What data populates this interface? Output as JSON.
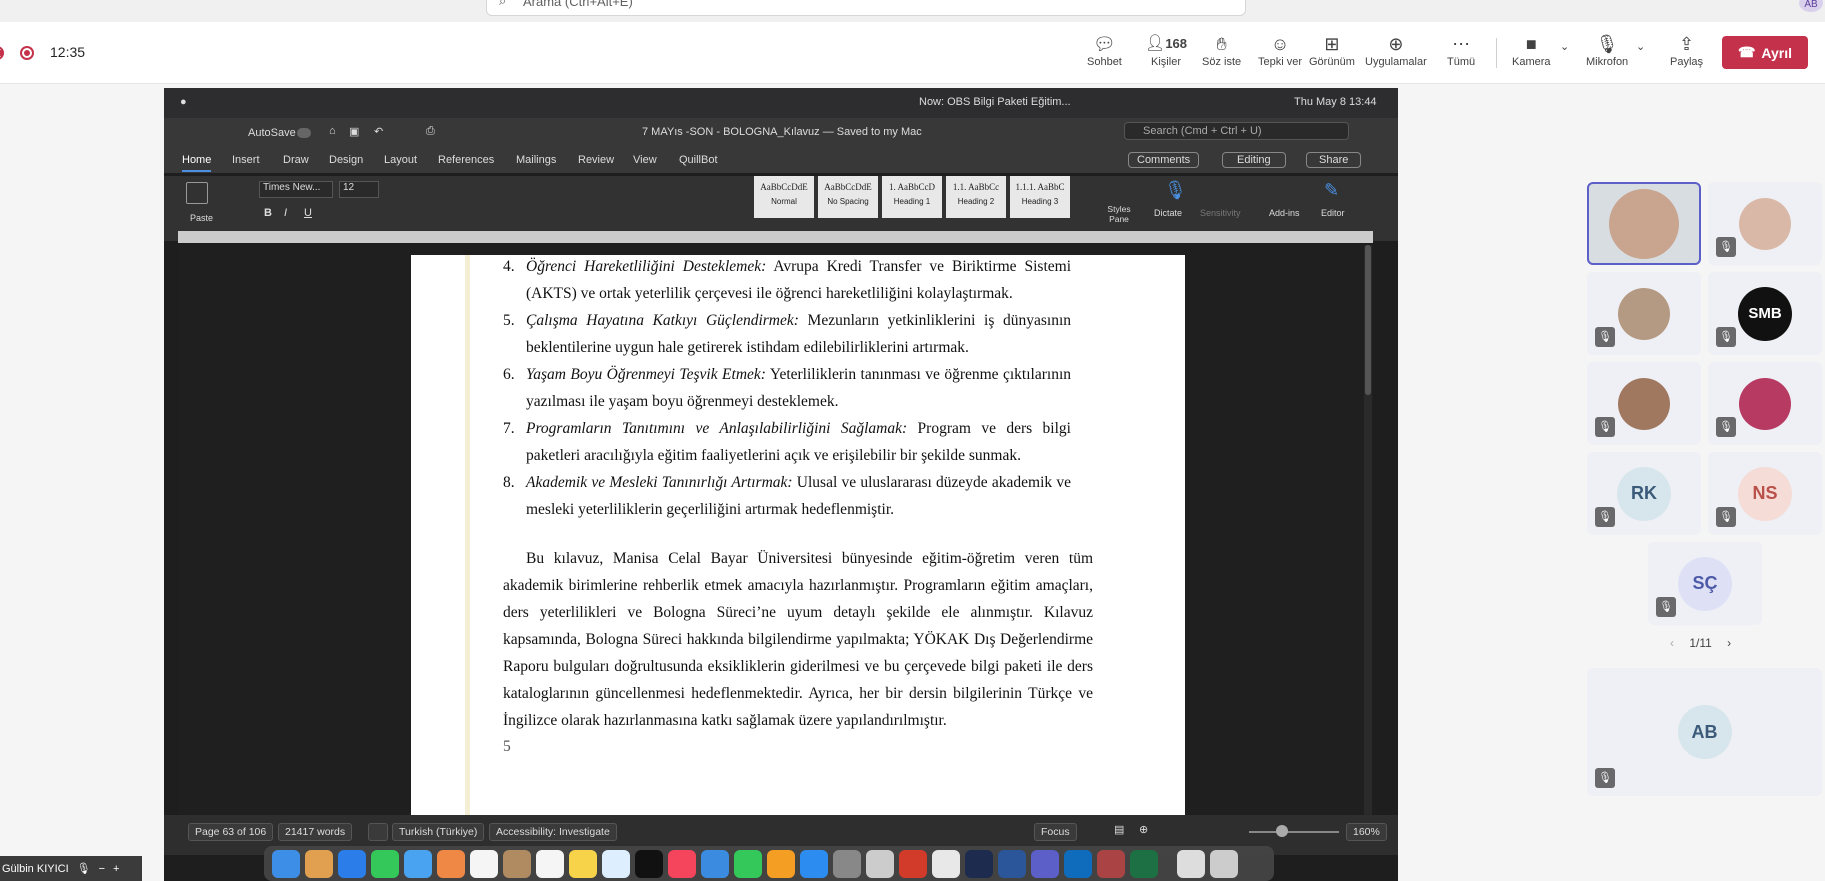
{
  "teams": {
    "search_placeholder": "Arama (Ctrl+Alt+E)",
    "corner_avatar": "AB",
    "timer": "12:35",
    "buttons": [
      {
        "label": "Sohbet",
        "icon": "chat-icon"
      },
      {
        "label": "Kişiler",
        "icon": "people-icon",
        "count": "168"
      },
      {
        "label": "Söz iste",
        "icon": "raise-hand-icon"
      },
      {
        "label": "Tepki ver",
        "icon": "reaction-icon"
      },
      {
        "label": "Görünüm",
        "icon": "view-icon"
      },
      {
        "label": "Uygulamalar",
        "icon": "apps-icon"
      },
      {
        "label": "Tümü",
        "icon": "more-icon"
      },
      {
        "label": "Kamera",
        "icon": "camera-off-icon"
      },
      {
        "label": "Mikrofon",
        "icon": "mic-off-icon"
      },
      {
        "label": "Paylaş",
        "icon": "share-icon"
      }
    ],
    "leave_label": "Ayrıl",
    "pager": "1/11",
    "participants": [
      {
        "kind": "photo",
        "color": "#c9a58f"
      },
      {
        "kind": "photo",
        "color": "#d9b8a7"
      },
      {
        "kind": "photo",
        "color": "#b59a83"
      },
      {
        "kind": "logo",
        "text": "SMB"
      },
      {
        "kind": "photo",
        "color": "#a07860"
      },
      {
        "kind": "photo",
        "color": "#b73a63"
      },
      {
        "kind": "initials",
        "text": "RK",
        "color": "#3b5a7a",
        "bg": "#d7e6ec"
      },
      {
        "kind": "initials",
        "text": "NS",
        "color": "#b9504a",
        "bg": "#f5dcd7"
      },
      {
        "kind": "initials",
        "text": "SÇ",
        "color": "#4d5aa8",
        "bg": "#dee0f5"
      },
      {
        "kind": "initials",
        "text": "AB",
        "color": "#3b5a7a",
        "bg": "#d7e6ec"
      }
    ],
    "presenter_name": "Gülbin KIYICI"
  },
  "mac": {
    "now_playing": "Now: OBS Bilgi Paketi Eğitim...",
    "clock": "Thu May 8  13:44"
  },
  "word": {
    "autosave": "AutoSave",
    "doc_title": "7 MAYıs -SON - BOLOGNA_Kılavuz — Saved to my Mac",
    "search_placeholder": "Search (Cmd + Ctrl + U)",
    "tabs": [
      "Home",
      "Insert",
      "Draw",
      "Design",
      "Layout",
      "References",
      "Mailings",
      "Review",
      "View",
      "QuillBot"
    ],
    "comments_label": "Comments",
    "editing_label": "Editing",
    "share_label": "Share",
    "paste_label": "Paste",
    "font_name": "Times New...",
    "font_size": "12",
    "styles": [
      {
        "sample": "AaBbCcDdE",
        "name": "Normal"
      },
      {
        "sample": "AaBbCcDdE",
        "name": "No Spacing"
      },
      {
        "sample": "1. AaBbCcD",
        "name": "Heading 1"
      },
      {
        "sample": "1.1. AaBbCc",
        "name": "Heading 2"
      },
      {
        "sample": "1.1.1. AaBbC",
        "name": "Heading 3"
      }
    ],
    "styles_pane": "Styles Pane",
    "dictate": "Dictate",
    "sensitivity": "Sensitivity",
    "addins": "Add-ins",
    "editor": "Editor",
    "status": {
      "page": "Page 63 of 106",
      "words": "21417 words",
      "language": "Turkish (Türkiye)",
      "accessibility": "Accessibility: Investigate",
      "focus": "Focus",
      "zoom": "160%"
    }
  },
  "document": {
    "list": [
      {
        "n": "4.",
        "title": "Öğrenci Hareketliliğini Desteklemek:",
        "body": " Avrupa Kredi Transfer ve Biriktirme Sistemi (AKTS) ve ortak yeterlilik çerçevesi ile öğrenci hareketliliğini kolaylaştırmak."
      },
      {
        "n": "5.",
        "title": "Çalışma Hayatına Katkıyı Güçlendirmek:",
        "body": " Mezunların yetkinliklerini iş dünyasının beklentilerine uygun hale getirerek istihdam edilebilirliklerini artırmak."
      },
      {
        "n": "6.",
        "title": "Yaşam Boyu Öğrenmeyi Teşvik Etmek:",
        "body": " Yeterliliklerin tanınması ve öğrenme çıktılarının yazılması ile yaşam boyu öğrenmeyi desteklemek."
      },
      {
        "n": "7.",
        "title": "Programların Tanıtımını ve Anlaşılabilirliğini Sağlamak:",
        "body": " Program ve ders bilgi paketleri aracılığıyla eğitim faaliyetlerini açık ve erişilebilir bir şekilde sunmak."
      },
      {
        "n": "8.",
        "title": "Akademik ve Mesleki Tanınırlığı Artırmak:",
        "body": " Ulusal ve uluslararası düzeyde akademik ve mesleki yeterliliklerin geçerliliğini artırmak hedeflenmiştir."
      }
    ],
    "paragraph": "Bu kılavuz, Manisa Celal Bayar Üniversitesi bünyesinde eğitim-öğretim veren tüm akademik birimlerine rehberlik etmek amacıyla hazırlanmıştır. Programların eğitim amaçları, ders yeterlilikleri ve Bologna Süreci’ne uyum detaylı şekilde ele alınmıştır. Kılavuz kapsamında, Bologna Süreci hakkında bilgilendirme yapılmakta; YÖKAK Dış Değerlendirme Raporu bulguları doğrultusunda eksikliklerin giderilmesi ve bu çerçevede bilgi paketi ile ders kataloglarının güncellenmesi hedeflenmektedir. Ayrıca, her bir dersin bilgilerinin Türkçe ve İngilizce olarak hazırlanmasına katkı sağlamak üzere yapılandırılmıştır.",
    "page_number": "5"
  }
}
